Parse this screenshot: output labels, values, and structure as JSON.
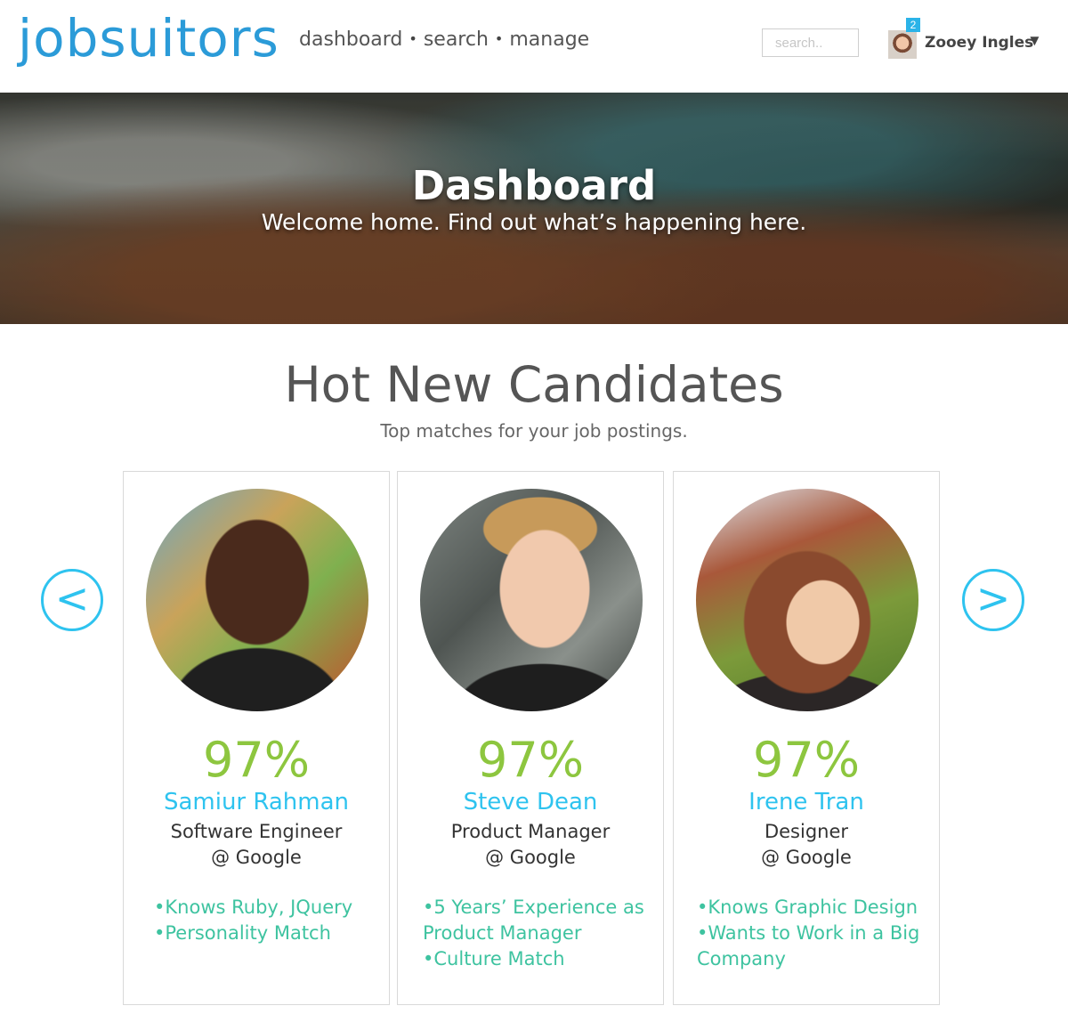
{
  "header": {
    "logo": "jobsuitors",
    "nav": [
      {
        "label": "dashboard"
      },
      {
        "label": "search"
      },
      {
        "label": "manage"
      }
    ],
    "nav_separator": "•",
    "search_placeholder": "search..",
    "user": {
      "name": "Zooey Ingles",
      "notifications": "2",
      "caret": "▼"
    }
  },
  "hero": {
    "title": "Dashboard",
    "subtitle": "Welcome home. Find out what’s happening here."
  },
  "section": {
    "title": "Hot New Candidates",
    "subtitle": "Top matches for your job postings."
  },
  "carousel": {
    "prev_label": "<",
    "next_label": ">"
  },
  "candidates": [
    {
      "match": "97%",
      "name": "Samiur Rahman",
      "title": "Software Engineer",
      "company": "@ Google",
      "highlights": [
        "Knows Ruby, JQuery",
        "Personality Match"
      ]
    },
    {
      "match": "97%",
      "name": "Steve Dean",
      "title": "Product Manager",
      "company": "@ Google",
      "highlights": [
        "5 Years’ Experience as Product Manager",
        "Culture Match"
      ]
    },
    {
      "match": "97%",
      "name": "Irene Tran",
      "title": "Designer",
      "company": "@ Google",
      "highlights": [
        "Knows Graphic Design",
        "Wants to Work in a Big Company"
      ]
    }
  ],
  "colors": {
    "brand": "#2b9bd8",
    "accent": "#2ec3ef",
    "match_green": "#8dc63f",
    "highlight_teal": "#3ec3a0"
  }
}
